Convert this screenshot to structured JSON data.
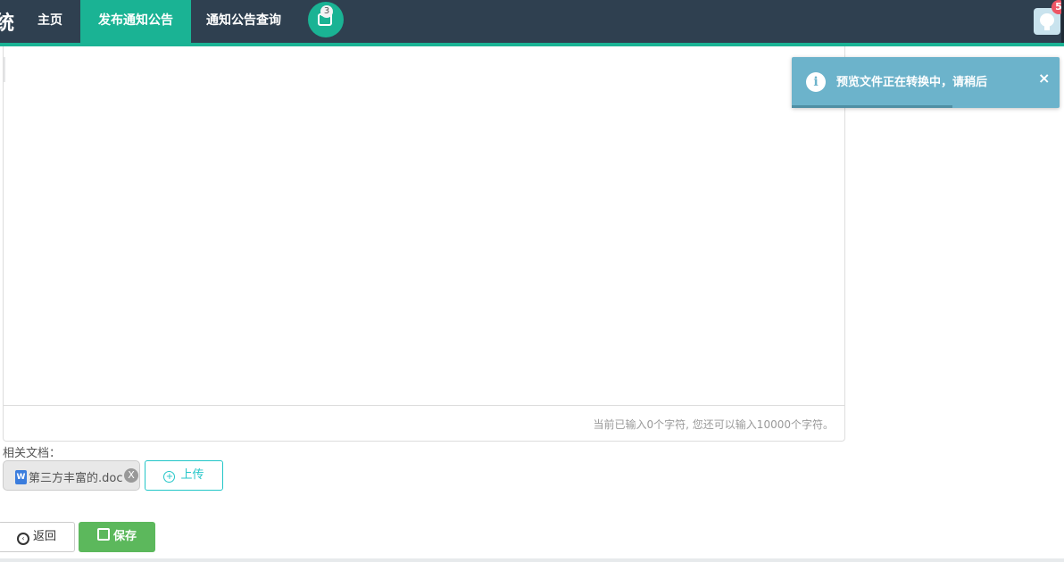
{
  "topbar": {
    "brand_fragment": "统",
    "nav_items": [
      "主页",
      "发布通知公告",
      "通知公告查询"
    ],
    "active_nav": "发布通知公告",
    "message_count": "3",
    "avatar_badge": "5"
  },
  "editor": {
    "char_count_text": "当前已输入0个字符, 您还可以输入10000个字符。"
  },
  "attachments": {
    "label": "相关文档：",
    "files": [
      "第三方丰富的.doc"
    ],
    "remove_glyph": "X",
    "file_icon_letter": "W",
    "upload_label": "上传"
  },
  "actions": {
    "back_label": "返回",
    "save_label": "保存"
  },
  "toast": {
    "message": "预览文件正在转换中，请稍后",
    "close_glyph": "×",
    "icon_glyph": "i",
    "progress": 0.6
  },
  "colors": {
    "topbar": "#2f4050",
    "accent": "#1ab394",
    "upload": "#23c6c8",
    "save": "#5cb85c",
    "toast": "#6cb3cb",
    "badge": "#ed5565"
  }
}
